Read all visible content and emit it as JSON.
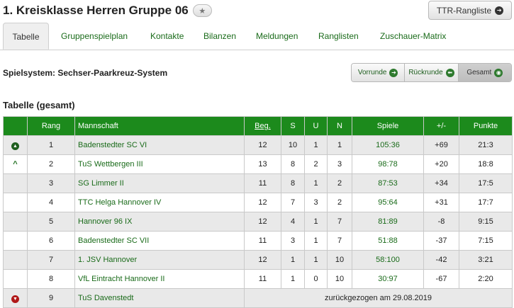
{
  "header": {
    "title": "1. Kreisklasse Herren Gruppe 06",
    "star_icon": "star-icon",
    "ttr_button": "TTR-Rangliste"
  },
  "tabs": [
    {
      "label": "Tabelle",
      "active": true
    },
    {
      "label": "Gruppenspielplan"
    },
    {
      "label": "Kontakte"
    },
    {
      "label": "Bilanzen"
    },
    {
      "label": "Meldungen"
    },
    {
      "label": "Ranglisten"
    },
    {
      "label": "Zuschauer-Matrix"
    }
  ],
  "spielsystem": "Spielsystem: Sechser-Paarkreuz-System",
  "segment": {
    "vorrunde": "Vorrunde",
    "rueckrunde": "Rückrunde",
    "gesamt": "Gesamt",
    "selected": "Gesamt"
  },
  "section_title": "Tabelle (gesamt)",
  "table": {
    "headers": {
      "rang": "Rang",
      "mannschaft": "Mannschaft",
      "beg": "Beg.",
      "s": "S",
      "u": "U",
      "n": "N",
      "spiele": "Spiele",
      "diff": "+/-",
      "punkte": "Punkte"
    },
    "rows": [
      {
        "trend": "up-circle",
        "rang": "1",
        "team": "Badenstedter SC VI",
        "beg": "12",
        "s": "10",
        "u": "1",
        "n": "1",
        "spiele": "105:36",
        "diff": "+69",
        "punkte": "21:3"
      },
      {
        "trend": "up",
        "rang": "2",
        "team": "TuS Wettbergen III",
        "beg": "13",
        "s": "8",
        "u": "2",
        "n": "3",
        "spiele": "98:78",
        "diff": "+20",
        "punkte": "18:8"
      },
      {
        "trend": "",
        "rang": "3",
        "team": "SG Limmer II",
        "beg": "11",
        "s": "8",
        "u": "1",
        "n": "2",
        "spiele": "87:53",
        "diff": "+34",
        "punkte": "17:5"
      },
      {
        "trend": "",
        "rang": "4",
        "team": "TTC Helga Hannover IV",
        "beg": "12",
        "s": "7",
        "u": "3",
        "n": "2",
        "spiele": "95:64",
        "diff": "+31",
        "punkte": "17:7"
      },
      {
        "trend": "",
        "rang": "5",
        "team": "Hannover 96 IX",
        "beg": "12",
        "s": "4",
        "u": "1",
        "n": "7",
        "spiele": "81:89",
        "diff": "-8",
        "punkte": "9:15"
      },
      {
        "trend": "",
        "rang": "6",
        "team": "Badenstedter SC VII",
        "beg": "11",
        "s": "3",
        "u": "1",
        "n": "7",
        "spiele": "51:88",
        "diff": "-37",
        "punkte": "7:15"
      },
      {
        "trend": "",
        "rang": "7",
        "team": "1. JSV Hannover",
        "beg": "12",
        "s": "1",
        "u": "1",
        "n": "10",
        "spiele": "58:100",
        "diff": "-42",
        "punkte": "3:21"
      },
      {
        "trend": "",
        "rang": "8",
        "team": "VfL Eintracht Hannover II",
        "beg": "11",
        "s": "1",
        "u": "0",
        "n": "10",
        "spiele": "30:97",
        "diff": "-67",
        "punkte": "2:20"
      }
    ],
    "withdrawn_row": {
      "trend": "down-circle",
      "rang": "9",
      "team": "TuS Davenstedt",
      "note": "zurückgezogen am 29.08.2019"
    }
  }
}
